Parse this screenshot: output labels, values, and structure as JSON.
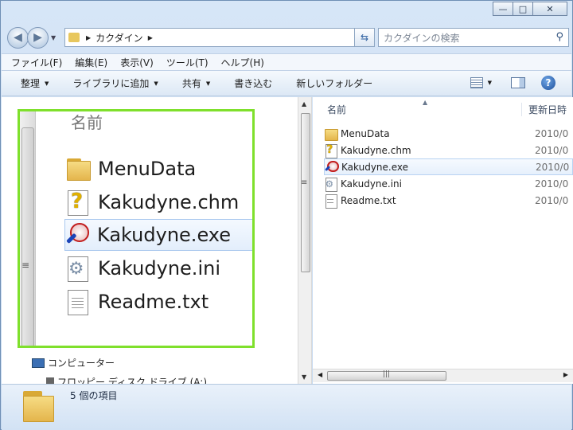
{
  "window": {
    "caption_minimize": "—",
    "caption_maximize": "□",
    "caption_close": "✕"
  },
  "address": {
    "crumb": "カクダイン",
    "search_placeholder": "カクダインの検索"
  },
  "menu": [
    "ファイル(F)",
    "編集(E)",
    "表示(V)",
    "ツール(T)",
    "ヘルプ(H)"
  ],
  "commands": {
    "organize": "整理",
    "add_to_library": "ライブラリに追加",
    "share": "共有",
    "burn": "書き込む",
    "new_folder": "新しいフォルダー"
  },
  "zoom": {
    "header": "名前",
    "items": [
      {
        "name": "MenuData",
        "icon": "folder-icon"
      },
      {
        "name": "Kakudyne.chm",
        "icon": "help-file-icon"
      },
      {
        "name": "Kakudyne.exe",
        "icon": "app-exe-icon"
      },
      {
        "name": "Kakudyne.ini",
        "icon": "settings-file-icon"
      },
      {
        "name": "Readme.txt",
        "icon": "text-file-icon"
      }
    ]
  },
  "nav": {
    "computer": "コンピューター",
    "floppy": "フロッピー ディスク ドライブ (A:)"
  },
  "list": {
    "col_name": "名前",
    "col_date": "更新日時",
    "rows": [
      {
        "name": "MenuData",
        "date": "2010/0",
        "icon": "folder-icon"
      },
      {
        "name": "Kakudyne.chm",
        "date": "2010/0",
        "icon": "help-file-icon"
      },
      {
        "name": "Kakudyne.exe",
        "date": "2010/0",
        "icon": "app-exe-icon",
        "selected": true
      },
      {
        "name": "Kakudyne.ini",
        "date": "2010/0",
        "icon": "settings-file-icon"
      },
      {
        "name": "Readme.txt",
        "date": "2010/0",
        "icon": "text-file-icon"
      }
    ]
  },
  "details": {
    "count": "5 個の項目"
  },
  "colors": {
    "highlight_frame": "#7fe02c",
    "selection": "#e3eefb"
  }
}
